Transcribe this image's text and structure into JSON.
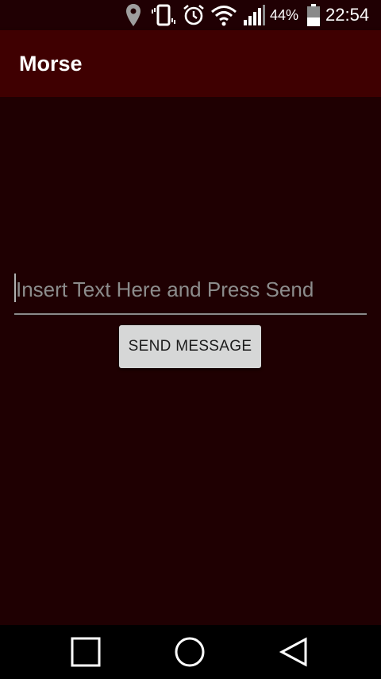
{
  "status_bar": {
    "battery_percent": "44%",
    "battery_level": 0.44,
    "time": "22:54",
    "icons": [
      "location-icon",
      "vibrate-icon",
      "alarm-icon",
      "wifi-icon",
      "signal-icon",
      "battery-icon"
    ]
  },
  "app_bar": {
    "title": "Morse"
  },
  "main": {
    "input_placeholder": "Insert Text Here and Press Send",
    "send_button_label": "SEND MESSAGE"
  },
  "nav_bar": {
    "icons": [
      "recent-apps-icon",
      "home-icon",
      "back-icon"
    ]
  },
  "colors": {
    "background": "#1f0002",
    "app_bar": "#3f0001",
    "button": "#d6d7d7"
  }
}
